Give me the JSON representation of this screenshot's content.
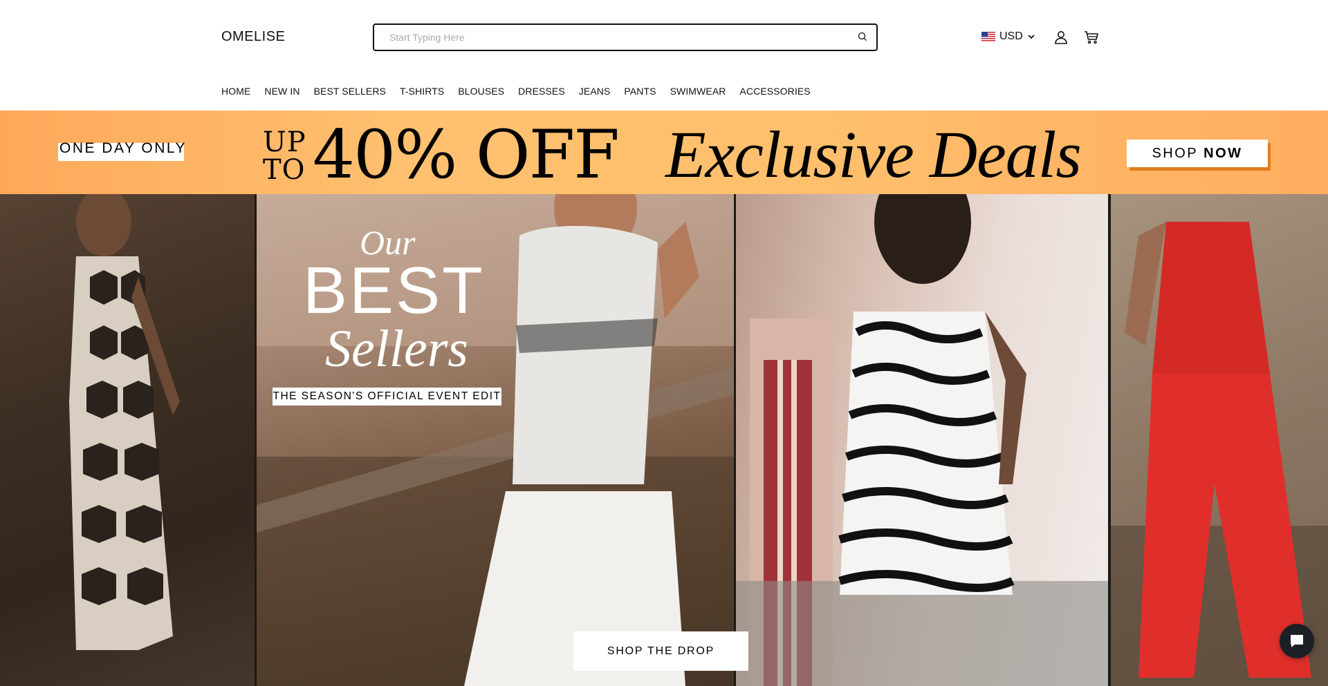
{
  "header": {
    "logo": "OMELISE",
    "search_placeholder": "Start Typing Here",
    "currency": "USD"
  },
  "nav": [
    "HOME",
    "NEW IN",
    "BEST SELLERS",
    "T-SHIRTS",
    "BLOUSES",
    "DRESSES",
    "JEANS",
    "PANTS",
    "SWIMWEAR",
    "ACCESSORIES"
  ],
  "banner": {
    "tag": "ONE DAY ONLY",
    "up": "UP",
    "to": "TO",
    "discount": "40% OFF",
    "headline": "Exclusive Deals",
    "cta_light": "SHOP",
    "cta_bold": "NOW"
  },
  "hero": {
    "our": "Our",
    "best": "BEST",
    "sellers": "Sellers",
    "subtitle": "THE SEASON'S OFFICIAL EVENT EDIT",
    "cta": "SHOP THE DROP"
  },
  "colors": {
    "banner_orange": "#ffa85a",
    "banner_yellow": "#ffc06f",
    "cta_shadow": "#e07b1c",
    "chat_bg": "#1c1f26"
  },
  "icons": [
    "search-icon",
    "us-flag-icon",
    "chevron-down-icon",
    "user-icon",
    "cart-icon",
    "chat-icon"
  ]
}
